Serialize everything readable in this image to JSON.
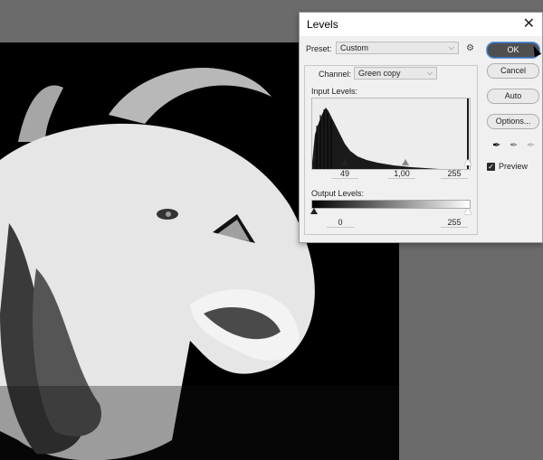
{
  "dialog": {
    "title": "Levels",
    "preset_label": "Preset:",
    "preset_value": "Custom",
    "channel_label": "Channel:",
    "channel_value": "Green copy",
    "input_levels_label": "Input Levels:",
    "input_black": "49",
    "input_gamma": "1,00",
    "input_white": "255",
    "output_levels_label": "Output Levels:",
    "output_black": "0",
    "output_white": "255",
    "buttons": {
      "ok": "OK",
      "cancel": "Cancel",
      "auto": "Auto",
      "options": "Options..."
    },
    "preview_label": "Preview",
    "preview_checked": true
  },
  "icons": {
    "close": "close-icon",
    "gear": "gear-icon",
    "droppers": [
      "black-eyedropper-icon",
      "gray-eyedropper-icon",
      "white-eyedropper-icon"
    ]
  },
  "colors": {
    "ok_accent": "#3b6fb3",
    "histogram_fill": "#1a1a1a"
  }
}
